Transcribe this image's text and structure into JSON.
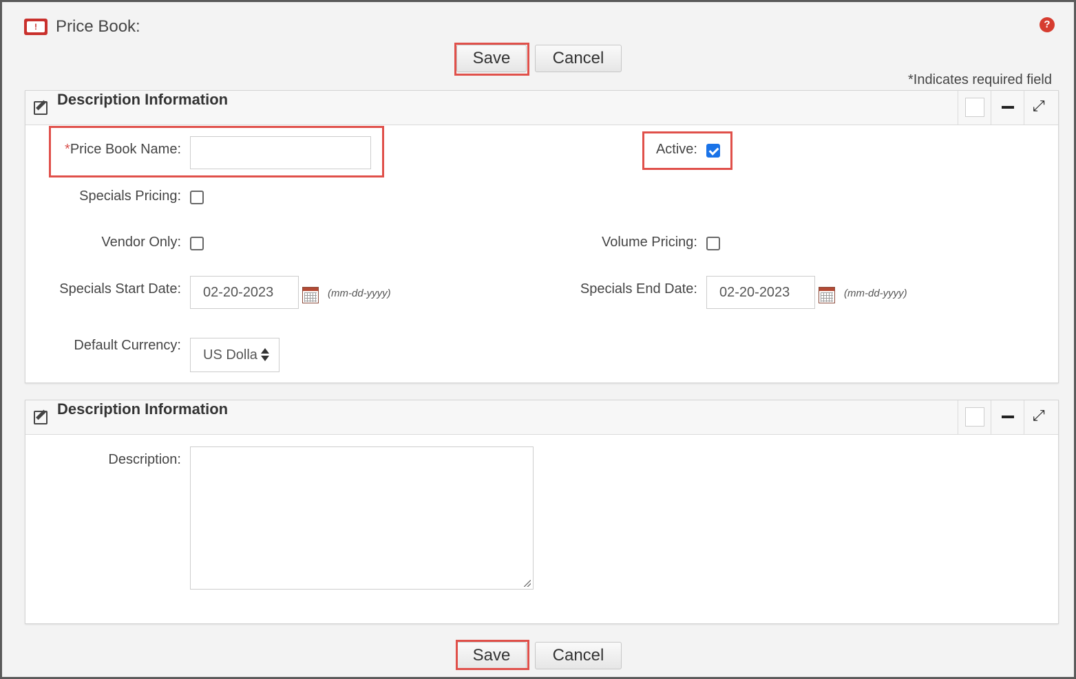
{
  "page": {
    "title": "Price Book:",
    "required_note": "*Indicates required field"
  },
  "buttons": {
    "save_label": "Save",
    "cancel_label": "Cancel"
  },
  "panels": [
    {
      "title": "Description Information",
      "fields": {
        "price_book_name": {
          "required_mark": "*",
          "label": "Price Book Name:",
          "value": ""
        },
        "active": {
          "label": "Active:",
          "checked": true
        },
        "specials_pricing": {
          "label": "Specials Pricing:",
          "checked": false
        },
        "vendor_only": {
          "label": "Vendor Only:",
          "checked": false
        },
        "volume_pricing": {
          "label": "Volume Pricing:",
          "checked": false
        },
        "specials_start_date": {
          "label": "Specials Start Date:",
          "value": "02-20-2023",
          "format_hint": "(mm-dd-yyyy)"
        },
        "specials_end_date": {
          "label": "Specials End Date:",
          "value": "02-20-2023",
          "format_hint": "(mm-dd-yyyy)"
        },
        "default_currency": {
          "label": "Default Currency:",
          "value": "US Dolla"
        }
      }
    },
    {
      "title": "Description Information",
      "fields": {
        "description": {
          "label": "Description:",
          "value": ""
        }
      }
    }
  ],
  "icons": {
    "header_icon": "price-book-icon",
    "help": "help-icon",
    "panel_edit": "edit-icon",
    "minimize": "minus-icon",
    "expand": "expand-icon",
    "calendar": "calendar-icon"
  },
  "colors": {
    "highlight": "#e0504a",
    "checkbox_checked": "#1a73e8",
    "required_star": "#d9534f"
  }
}
